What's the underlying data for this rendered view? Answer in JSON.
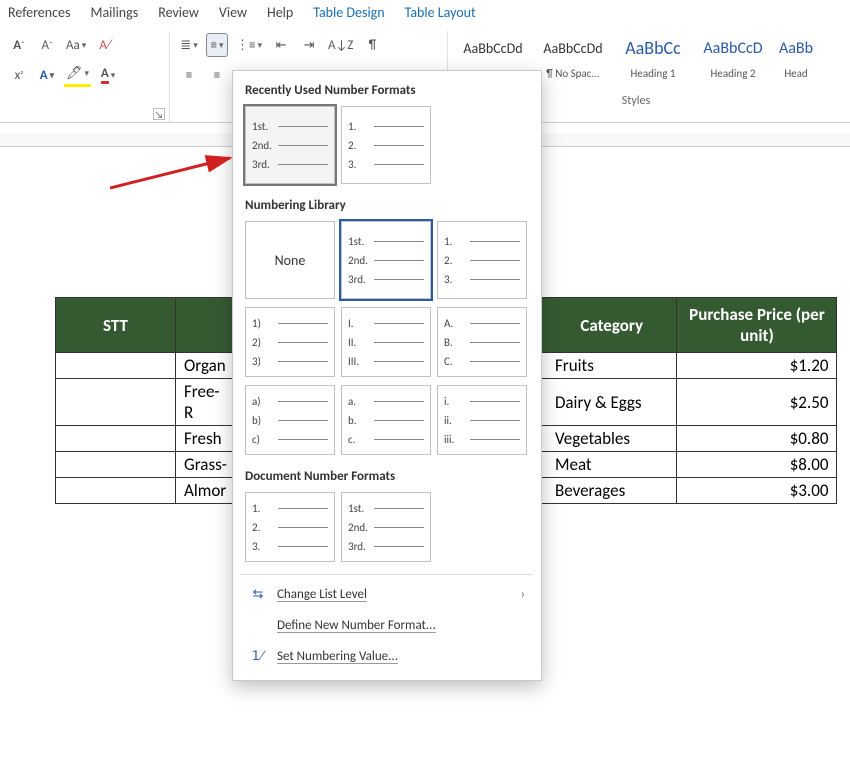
{
  "tabs": {
    "references": "References",
    "mailings": "Mailings",
    "review": "Review",
    "view": "View",
    "help": "Help",
    "table_design": "Table Design",
    "table_layout": "Table Layout"
  },
  "styles": {
    "caption": "Styles",
    "items": [
      {
        "preview": "AaBbCcDd",
        "label": "",
        "size": "14px",
        "color": "#333"
      },
      {
        "preview": "AaBbCcDd",
        "label": "¶ No Spac...",
        "size": "14px",
        "color": "#333"
      },
      {
        "preview": "AaBbCc",
        "label": "Heading 1",
        "size": "18px",
        "color": "#2a5aa8"
      },
      {
        "preview": "AaBbCcD",
        "label": "Heading 2",
        "size": "16px",
        "color": "#2a5aa8"
      },
      {
        "preview": "AaBb",
        "label": "Head",
        "size": "16px",
        "color": "#2a5aa8"
      }
    ]
  },
  "table": {
    "headers": {
      "stt": "STT",
      "item": "",
      "category": "Category",
      "price": "Purchase Price (per unit)"
    },
    "col1_partial": [
      "Organ",
      "Free-R",
      "Fresh",
      "Grass-",
      "Almor"
    ],
    "rows": [
      {
        "category": "Fruits",
        "price": "$1.20"
      },
      {
        "category": "Dairy & Eggs",
        "price": "$2.50"
      },
      {
        "category": "Vegetables",
        "price": "$0.80"
      },
      {
        "category": "Meat",
        "price": "$8.00"
      },
      {
        "category": "Beverages",
        "price": "$3.00"
      }
    ]
  },
  "dropdown": {
    "recent_heading": "Recently Used Number Formats",
    "library_heading": "Numbering Library",
    "doc_heading": "Document Number Formats",
    "none": "None",
    "formats": {
      "ordinal": [
        "1st.",
        "2nd.",
        "3rd."
      ],
      "decimal_dot": [
        "1.",
        "2.",
        "3."
      ],
      "paren_num": [
        "1)",
        "2)",
        "3)"
      ],
      "roman": [
        "I.",
        "II.",
        "III."
      ],
      "upper_alpha": [
        "A.",
        "B.",
        "C."
      ],
      "lower_a_paren": [
        "a)",
        "b)",
        "c)"
      ],
      "lower_a_dot": [
        "a.",
        "b.",
        "c."
      ],
      "lower_roman": [
        "i.",
        "ii.",
        "iii."
      ]
    },
    "change_level": "Change List Level",
    "define_new": "Define New Number Format...",
    "set_value": "Set Numbering Value..."
  }
}
